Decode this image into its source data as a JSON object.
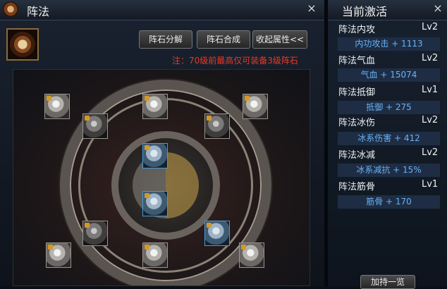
{
  "left_panel": {
    "title": "阵法",
    "buttons": {
      "decompose": "阵石分解",
      "combine": "阵石合成",
      "collapse": "收起属性<<"
    },
    "note": "注：70级前最高仅可装备3级阵石",
    "close_icon": "×"
  },
  "stones": [
    {
      "name": "slot-outer-top-left",
      "style": "light",
      "locked": true
    },
    {
      "name": "slot-inner-top-left",
      "style": "dark",
      "locked": true
    },
    {
      "name": "slot-top-center",
      "style": "light",
      "locked": true
    },
    {
      "name": "slot-inner-top-right",
      "style": "dark",
      "locked": true
    },
    {
      "name": "slot-outer-top-right",
      "style": "light",
      "locked": true
    },
    {
      "name": "slot-center-upper",
      "style": "blue",
      "locked": true
    },
    {
      "name": "slot-center-lower",
      "style": "blue",
      "locked": true
    },
    {
      "name": "slot-inner-bottom-left",
      "style": "dark",
      "locked": true
    },
    {
      "name": "slot-inner-bottom-right",
      "style": "blue",
      "locked": true
    },
    {
      "name": "slot-outer-bottom-left",
      "style": "light",
      "locked": true
    },
    {
      "name": "slot-bottom-center",
      "style": "light",
      "locked": true
    },
    {
      "name": "slot-outer-bottom-right",
      "style": "light",
      "locked": true
    }
  ],
  "right_panel": {
    "title": "当前激活",
    "close_icon": "×",
    "attributes": [
      {
        "name": "阵法内攻",
        "level": "Lv2",
        "value": "内功攻击 + 1113"
      },
      {
        "name": "阵法气血",
        "level": "Lv2",
        "value": "气血 + 15074"
      },
      {
        "name": "阵法抵御",
        "level": "Lv1",
        "value": "抵御 + 275"
      },
      {
        "name": "阵法冰伤",
        "level": "Lv2",
        "value": "冰系伤害 + 412"
      },
      {
        "name": "阵法冰减",
        "level": "Lv2",
        "value": "冰系减抗 + 15%"
      },
      {
        "name": "阵法筋骨",
        "level": "Lv1",
        "value": "筋骨 + 170"
      }
    ],
    "bottom_button": "加持一览"
  },
  "colors": {
    "note_red": "#e83a25",
    "value_blue": "#68b2f5"
  }
}
